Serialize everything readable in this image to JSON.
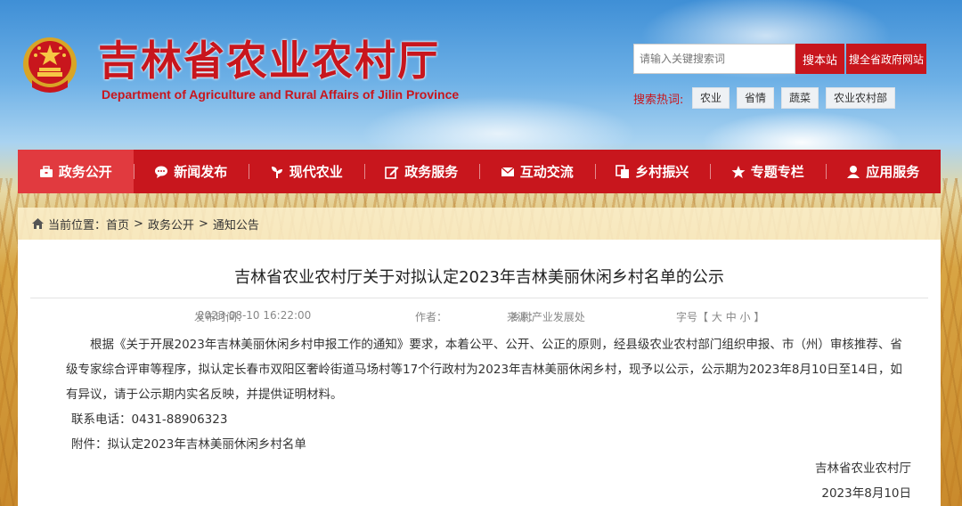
{
  "header": {
    "title": "吉林省农业农村厅",
    "subtitle": "Department of Agriculture and Rural Affairs of Jilin Province"
  },
  "search": {
    "placeholder": "请输入关键搜索词",
    "site_button": "搜本站",
    "gov_button": "搜全省政府网站",
    "hot_label": "搜索热词:",
    "hot_words": [
      "农业",
      "省情",
      "蔬菜",
      "农业农村部"
    ]
  },
  "nav": {
    "items": [
      {
        "label": "政务公开",
        "icon": "briefcase-icon"
      },
      {
        "label": "新闻发布",
        "icon": "chat-bubble-icon"
      },
      {
        "label": "现代农业",
        "icon": "seedling-icon"
      },
      {
        "label": "政务服务",
        "icon": "edit-icon"
      },
      {
        "label": "互动交流",
        "icon": "mail-icon"
      },
      {
        "label": "乡村振兴",
        "icon": "copy-icon"
      },
      {
        "label": "专题专栏",
        "icon": "star-icon"
      },
      {
        "label": "应用服务",
        "icon": "user-icon"
      }
    ],
    "active_color": "#e13a3f",
    "bar_color": "#c8161d"
  },
  "breadcrumb": {
    "prefix": "当前位置：",
    "items": [
      "首页",
      "政务公开",
      "通知公告"
    ],
    "separator": ">"
  },
  "article": {
    "title": "吉林省农业农村厅关于对拟认定2023年吉林美丽休闲乡村名单的公示",
    "publish_label": "发布时间：",
    "publish_time": "2023-08-10 16:22:00",
    "author_label": "作者：",
    "source_label": "来源：",
    "source": "乡村产业发展处",
    "fontsize_label": "字号",
    "fontsize_open": "【",
    "fontsize_big": "大",
    "fontsize_mid": "中",
    "fontsize_small": "小",
    "fontsize_close": "】",
    "paragraph": "根据《关于开展2023年吉林美丽休闲乡村申报工作的通知》要求，本着公平、公开、公正的原则，经县级农业农村部门组织申报、市（州）审核推荐、省级专家综合评审等程序，拟认定长春市双阳区奢岭街道马场村等17个行政村为2023年吉林美丽休闲乡村，现予以公示，公示期为2023年8月10日至14日，如有异议，请于公示期内实名反映，并提供证明材料。",
    "phone_line": "联系电话：0431-88906323",
    "attachment_label": "附件：",
    "attachment_link": "拟认定2023年吉林美丽休闲乡村名单",
    "signature": "吉林省农业农村厅",
    "date": "2023年8月10日"
  }
}
